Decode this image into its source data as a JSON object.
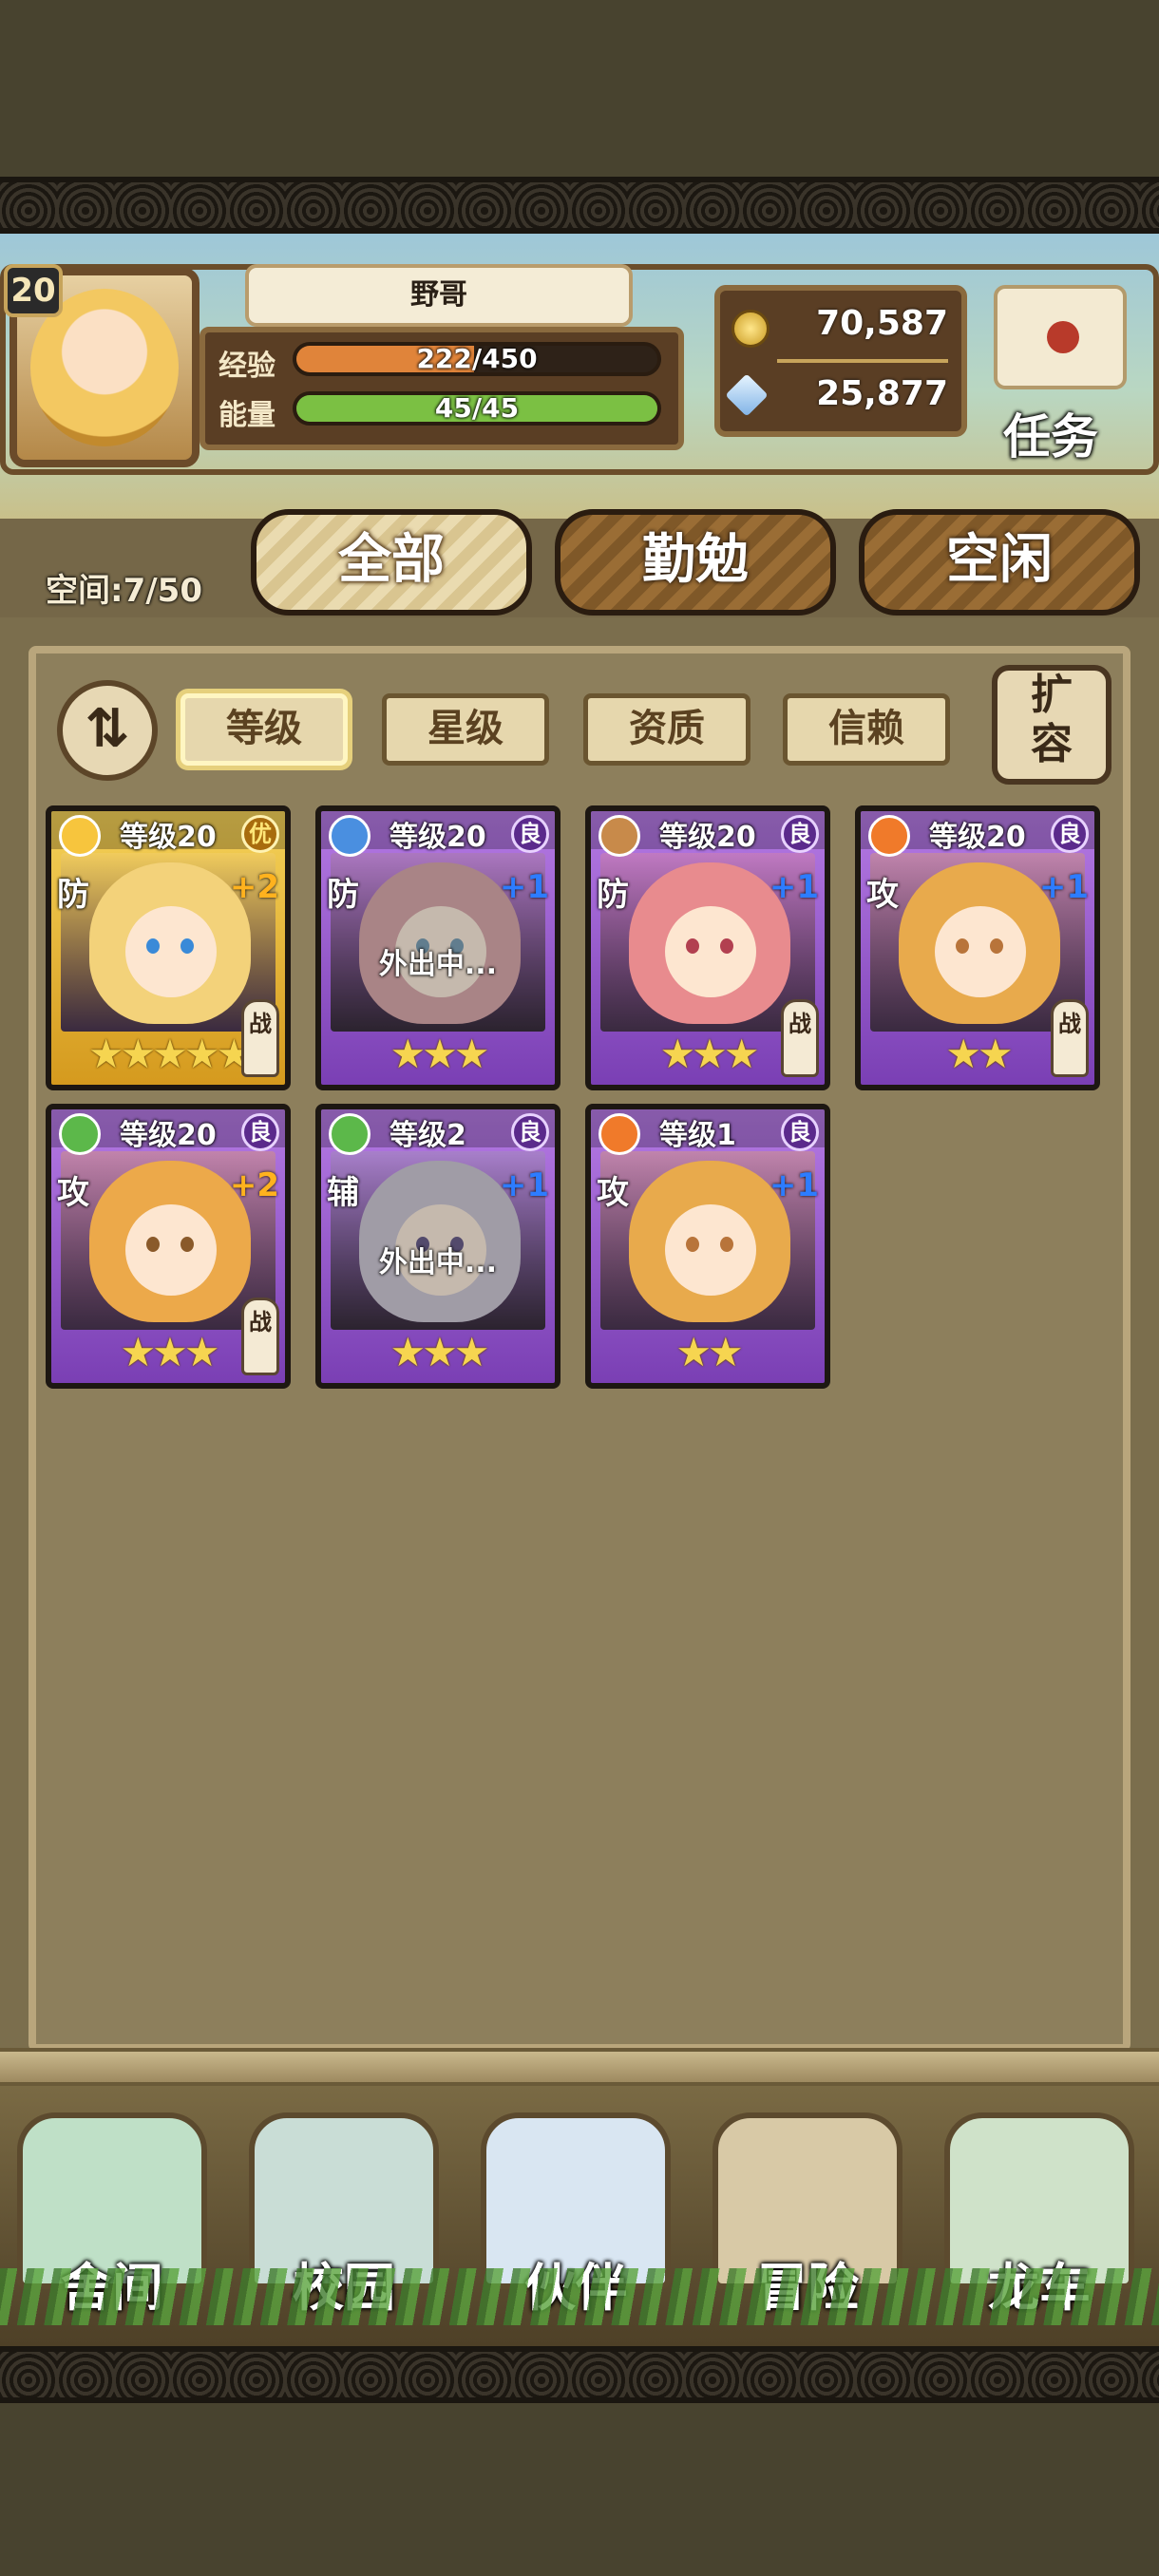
{
  "player": {
    "level": "20",
    "name": "野哥",
    "exp_label": "经验",
    "exp_value": "222/450",
    "exp_fraction": 0.493,
    "energy_label": "能量",
    "energy_value": "45/45",
    "energy_fraction": 1.0
  },
  "currency": {
    "gold": "70,587",
    "gems": "25,877"
  },
  "quest": {
    "label": "任务"
  },
  "tabs": {
    "space": "空间:7/50",
    "all": "全部",
    "diligent": "勤勉",
    "idle": "空闲"
  },
  "filters": {
    "sort_icon": "sort-arrows-icon",
    "level": "等级",
    "stars": "星级",
    "quality": "资质",
    "trust": "信赖",
    "expand_1": "扩",
    "expand_2": "容"
  },
  "cards": [
    {
      "level": "等级20",
      "grade": "优",
      "role": "防",
      "plus": "+2",
      "stars": "★★★★★",
      "battle": "战",
      "away": "",
      "frame": "gold",
      "element": "light"
    },
    {
      "level": "等级20",
      "grade": "良",
      "role": "防",
      "plus": "+1",
      "stars": "★★★",
      "battle": "",
      "away": "外出中...",
      "frame": "purple",
      "element": "water"
    },
    {
      "level": "等级20",
      "grade": "良",
      "role": "防",
      "plus": "+1",
      "stars": "★★★",
      "battle": "战",
      "away": "",
      "frame": "purple",
      "element": "earth"
    },
    {
      "level": "等级20",
      "grade": "良",
      "role": "攻",
      "plus": "+1",
      "stars": "★★",
      "battle": "战",
      "away": "",
      "frame": "purple",
      "element": "fire"
    },
    {
      "level": "等级20",
      "grade": "良",
      "role": "攻",
      "plus": "+2",
      "stars": "★★★",
      "battle": "战",
      "away": "",
      "frame": "purple",
      "element": "wood"
    },
    {
      "level": "等级2",
      "grade": "良",
      "role": "辅",
      "plus": "+1",
      "stars": "★★★",
      "battle": "",
      "away": "外出中...",
      "frame": "purple",
      "element": "wood"
    },
    {
      "level": "等级1",
      "grade": "良",
      "role": "攻",
      "plus": "+1",
      "stars": "★★",
      "battle": "",
      "away": "",
      "frame": "purple",
      "element": "fire"
    }
  ],
  "nav": [
    {
      "label": "舍间",
      "icon": "house-icon"
    },
    {
      "label": "校园",
      "icon": "school-icon"
    },
    {
      "label": "伙伴",
      "icon": "partner-icon"
    },
    {
      "label": "冒险",
      "icon": "adventure-icon"
    },
    {
      "label": "龙车",
      "icon": "wagon-icon"
    }
  ],
  "colors": {
    "exp_bar": "#e0843a",
    "energy_bar": "#7bc043",
    "gold_frame": "#e8b83a",
    "purple_frame": "#9a5ad0"
  }
}
